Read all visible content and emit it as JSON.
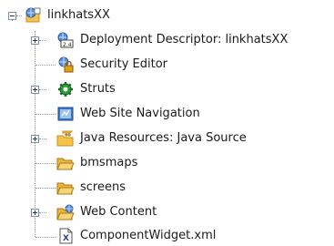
{
  "tree": {
    "root": {
      "label": "linkhatsXX",
      "icon": "web-project-icon",
      "expanded": true
    },
    "items": [
      {
        "label": "Deployment Descriptor: linkhatsXX",
        "icon": "deployment-descriptor-icon",
        "expandable": true
      },
      {
        "label": "Security Editor",
        "icon": "security-editor-icon",
        "expandable": false
      },
      {
        "label": "Struts",
        "icon": "struts-gear-icon",
        "expandable": true
      },
      {
        "label": "Web Site Navigation",
        "icon": "web-site-navigation-icon",
        "expandable": false
      },
      {
        "label": "Java Resources: Java Source",
        "icon": "java-resources-icon",
        "expandable": true
      },
      {
        "label": "bmsmaps",
        "icon": "folder-icon",
        "expandable": false
      },
      {
        "label": "screens",
        "icon": "folder-icon",
        "expandable": false
      },
      {
        "label": "Web Content",
        "icon": "web-content-folder-icon",
        "expandable": true
      },
      {
        "label": "ComponentWidget.xml",
        "icon": "xml-file-icon",
        "expandable": false
      }
    ],
    "colors": {
      "folder": "#f3c34a",
      "folder_dark": "#c98f1c",
      "gear": "#2e9b3a",
      "globe": "#3b78c4"
    }
  }
}
